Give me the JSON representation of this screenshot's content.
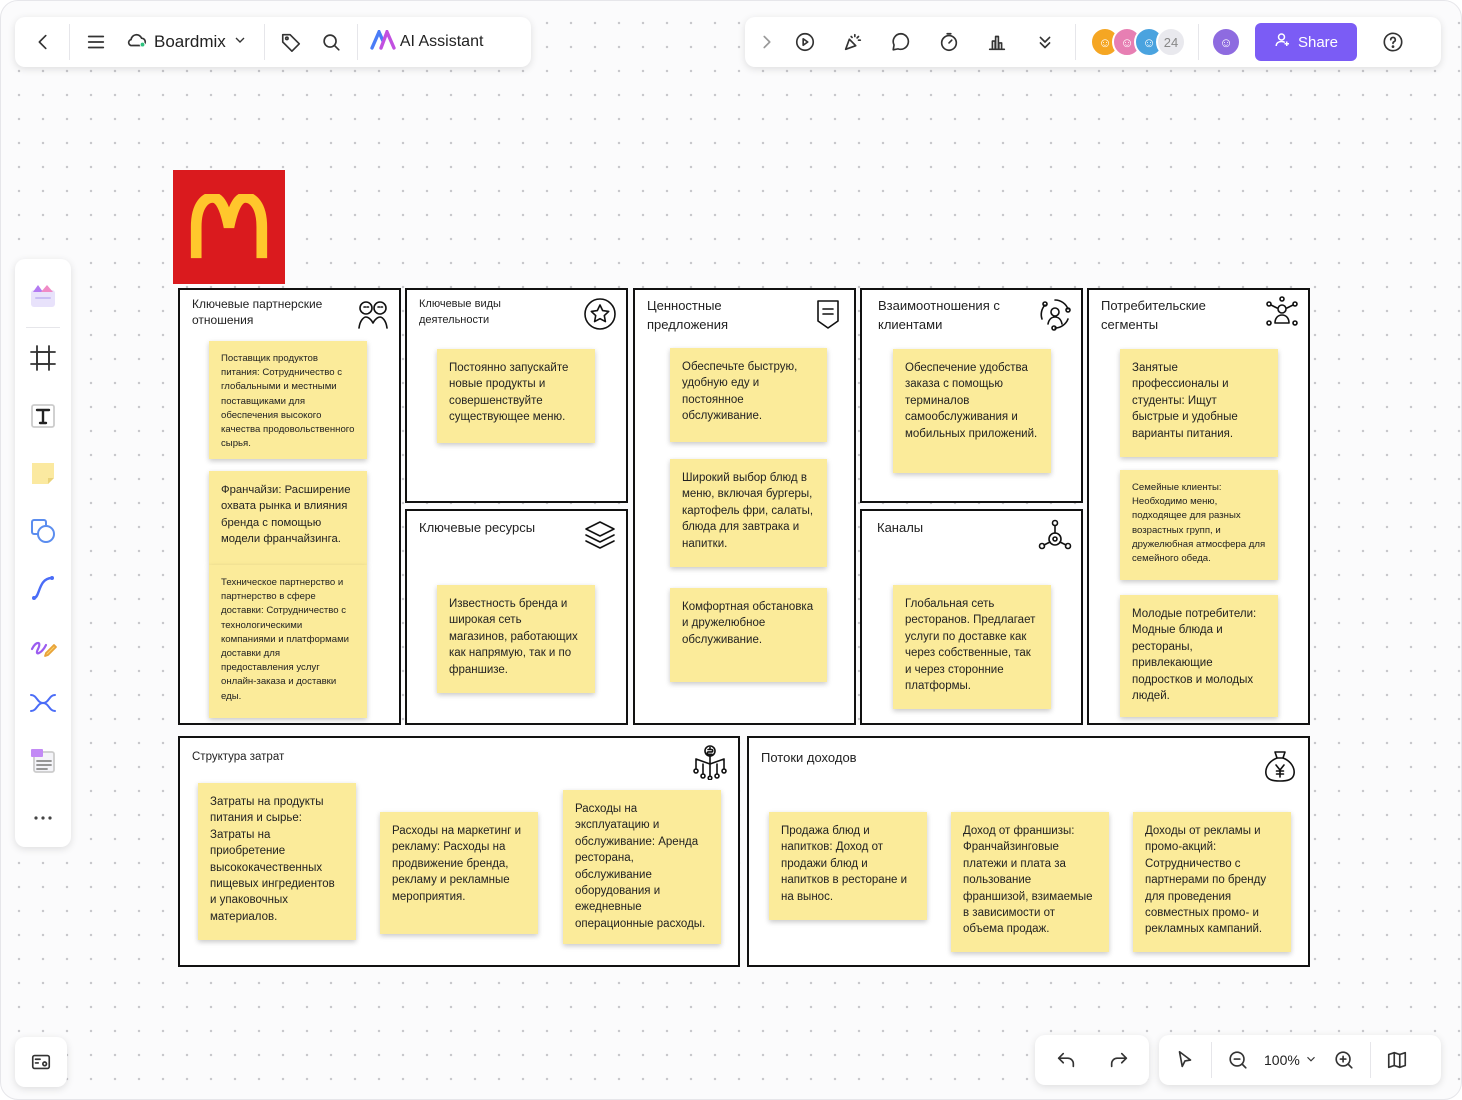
{
  "toolbar": {
    "brand": "Boardmix",
    "ai_label": "AI Assistant",
    "share_label": "Share",
    "collaborator_count": "24"
  },
  "zoom": {
    "level": "100%"
  },
  "colors": {
    "accent": "#7b5cf5",
    "sticky": "#fbeb9a",
    "logo_bg": "#da1a1e",
    "logo_arches": "#ffc72c"
  },
  "canvas": {
    "sections": {
      "key_partners": {
        "title": "Ключевые партнерские отношения",
        "notes": [
          "Поставщик продуктов питания: Сотрудничество с глобальными и местными поставщиками для обеспечения высокого качества продовольственного сырья.",
          "Франчайзи: Расширение охвата рынка и влияния бренда с помощью модели франчайзинга.",
          "Техническое партнерство и партнерство в сфере доставки: Сотрудничество с технологическими компаниями и платформами доставки для предоставления услуг онлайн-заказа и доставки еды."
        ]
      },
      "key_activities": {
        "title": "Ключевые виды деятельности",
        "notes": [
          "Постоянно запускайте новые продукты и совершенствуйте существующее меню."
        ]
      },
      "key_resources": {
        "title": "Ключевые ресурсы",
        "notes": [
          "Известность бренда и широкая сеть магазинов, работающих как напрямую, так и по франшизе."
        ]
      },
      "value_propositions": {
        "title": "Ценностные предложения",
        "notes": [
          "Обеспечьте быструю, удобную еду и постоянное обслуживание.",
          "Широкий выбор блюд в меню, включая бургеры, картофель фри, салаты, блюда для завтрака и напитки.",
          "Комфортная обстановка и дружелюбное обслуживание."
        ]
      },
      "customer_relationships": {
        "title": "Взаимоотношения с клиентами",
        "notes": [
          "Обеспечение удобства заказа с помощью терминалов самообслуживания и мобильных приложений."
        ]
      },
      "channels": {
        "title": "Каналы",
        "notes": [
          "Глобальная сеть ресторанов. Предлагает услуги по доставке как через собственные, так и через сторонние платформы."
        ]
      },
      "customer_segments": {
        "title": "Потребительские сегменты",
        "notes": [
          "Занятые профессионалы и студенты: Ищут быстрые и удобные варианты питания.",
          "Семейные клиенты: Необходимо меню, подходящее для разных возрастных групп, и дружелюбная атмосфера для семейного обеда.",
          "Молодые потребители: Модные блюда и рестораны, привлекающие подростков и молодых людей."
        ]
      },
      "cost_structure": {
        "title": "Структура затрат",
        "notes": [
          "Затраты на продукты питания и сырье: Затраты на приобретение высококачественных пищевых ингредиентов и упаковочных материалов.",
          "Расходы на маркетинг и рекламу: Расходы на продвижение бренда, рекламу и рекламные мероприятия.",
          "Расходы на эксплуатацию и обслуживание: Аренда ресторана, обслуживание оборудования и ежедневные операционные расходы."
        ]
      },
      "revenue_streams": {
        "title": "Потоки доходов",
        "notes": [
          "Продажа блюд и напитков: Доход от продажи блюд и напитков в ресторане и на вынос.",
          "Доход от франшизы: Франчайзинговые платежи и плата за пользование франшизой, взимаемые в зависимости от объема продаж.",
          "Доходы от рекламы и промо-акций: Сотрудничество с партнерами по бренду для проведения совместных промо- и рекламных кампаний."
        ]
      }
    }
  }
}
